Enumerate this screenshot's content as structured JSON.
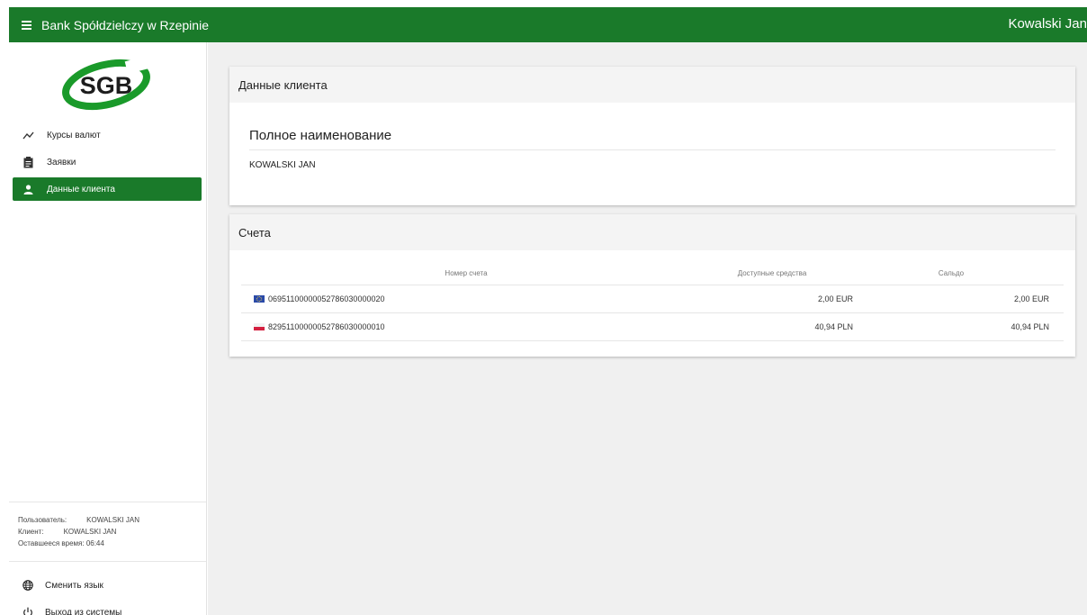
{
  "header": {
    "app_title": "Bank Spółdzielczy w Rzepinie",
    "user_name": "Kowalski Jan",
    "color": "#1a7a2a"
  },
  "sidebar": {
    "logo_text": "SGB",
    "items": [
      {
        "label": "Курсы валют",
        "icon": "trending-up-icon"
      },
      {
        "label": "Заявки",
        "icon": "clipboard-icon"
      },
      {
        "label": "Данные клиента",
        "icon": "person-icon",
        "active": true
      }
    ],
    "session": {
      "user_label": "Пользователь:",
      "user_value": "KOWALSKI JAN",
      "client_label": "Клиент:",
      "client_value": "KOWALSKI JAN",
      "time_label": "Оставшееся время:",
      "time_value": "06:44"
    },
    "bottom": [
      {
        "label": "Сменить язык",
        "icon": "globe-icon"
      },
      {
        "label": "Выход из системы",
        "icon": "power-icon"
      }
    ]
  },
  "client_card": {
    "title": "Данные клиента",
    "subtitle": "Полное наименование",
    "name": "KOWALSKI JAN"
  },
  "accounts_card": {
    "title": "Счета",
    "columns": [
      "Номер счета",
      "Доступные средства",
      "Сальдо"
    ],
    "rows": [
      {
        "flag": "eu-flag-icon",
        "number": "06951100000052786030000020",
        "available": "2,00 EUR",
        "balance": "2,00 EUR"
      },
      {
        "flag": "pl-flag-icon",
        "number": "82951100000052786030000010",
        "available": "40,94 PLN",
        "balance": "40,94 PLN"
      }
    ]
  }
}
